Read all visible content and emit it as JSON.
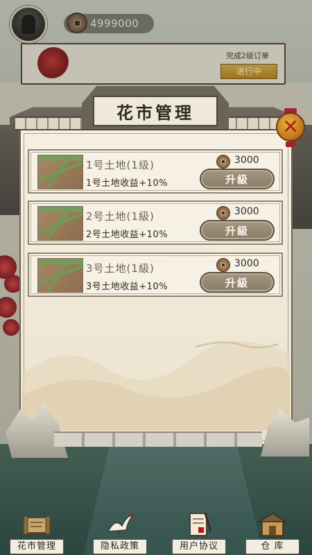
{
  "hud": {
    "coins": "4999000"
  },
  "order": {
    "title": "完成2级订单",
    "status_button": "进行中"
  },
  "dialog": {
    "title": "花市管理",
    "close_icon": "close-icon",
    "lands": [
      {
        "name": "1号土地(1级)",
        "desc": "1号土地收益+10%",
        "cost": "3000",
        "button": "升級"
      },
      {
        "name": "2号土地(1級)",
        "desc": "2号土地收益+10%",
        "cost": "3000",
        "button": "升級"
      },
      {
        "name": "3号土地(1級)",
        "desc": "3号土地收益+10%",
        "cost": "3000",
        "button": "升級"
      }
    ]
  },
  "nav": {
    "items": [
      {
        "label": "花市管理",
        "icon": "scroll-icon"
      },
      {
        "label": "隐私政策",
        "icon": "crane-icon"
      },
      {
        "label": "用户协议",
        "icon": "contract-icon"
      },
      {
        "label": "仓 库",
        "icon": "warehouse-icon"
      }
    ]
  },
  "colors": {
    "accent": "#8a7c66",
    "lantern": "#c2771b",
    "close_x": "#b31b1b",
    "order_button": "#c9a037"
  }
}
